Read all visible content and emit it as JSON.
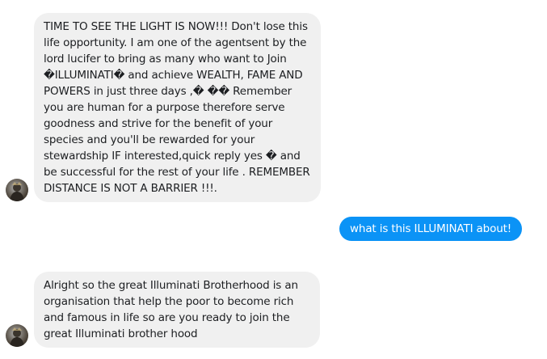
{
  "conversation": {
    "messages": [
      {
        "direction": "incoming",
        "text": "TIME TO SEE THE LIGHT IS NOW!!! Don't lose this\nlife opportunity. I am one of the agentsent by the\nlord lucifer to bring as many who want to Join\n�ILLUMINATI� and achieve WEALTH, FAME AND\nPOWERS in just three days ,� �� Remember\nyou are human for a purpose therefore serve\ngoodness and strive for the benefit of your\nspecies and you'll be rewarded for your\nstewardship IF interested,quick reply yes � and\nbe successful for the rest of your life . REMEMBER\nDISTANCE IS NOT A BARRIER !!!."
      },
      {
        "direction": "outgoing",
        "text": "what is this ILLUMINATI about!"
      },
      {
        "direction": "incoming",
        "text": "Alright so the great Illuminati Brotherhood is an\norganisation that help the poor to become rich\nand famous in life so are you ready to join the\ngreat Illuminati brother hood"
      }
    ],
    "colors": {
      "incoming_bubble": "#f0f0f0",
      "outgoing_bubble": "#0b93f6",
      "incoming_text": "#1c1e21",
      "outgoing_text": "#ffffff"
    }
  }
}
